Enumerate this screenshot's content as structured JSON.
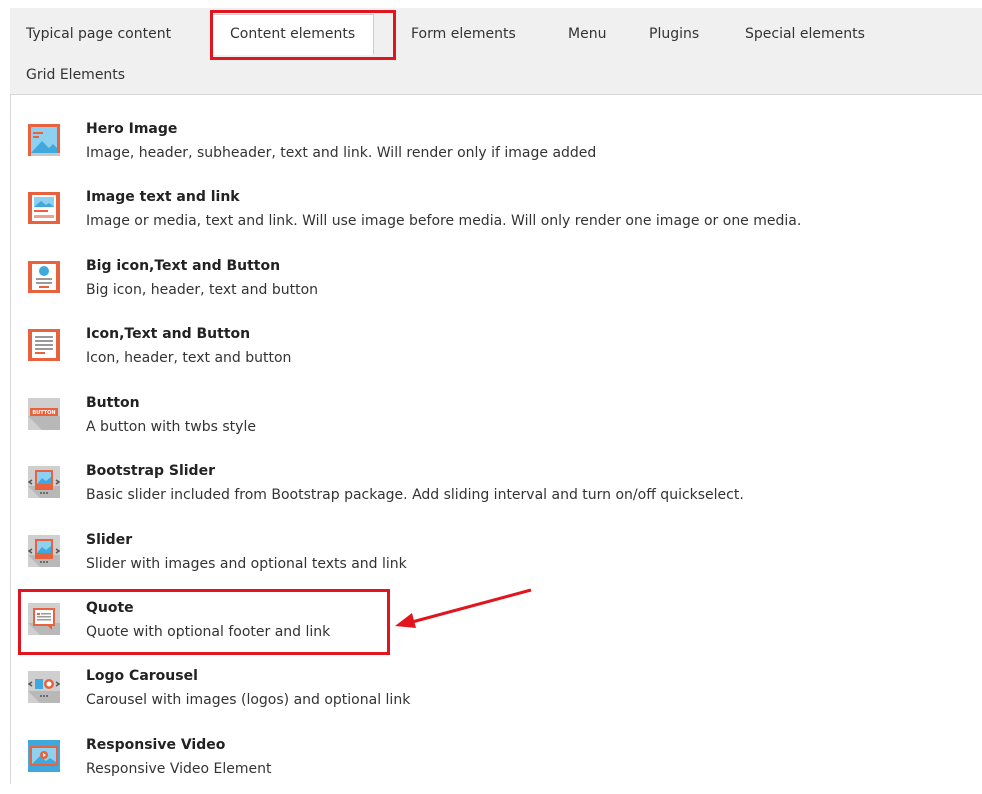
{
  "tabs": [
    {
      "label": "Typical page content"
    },
    {
      "label": "Content elements",
      "active": true
    },
    {
      "label": "Form elements"
    },
    {
      "label": "Menu"
    },
    {
      "label": "Plugins"
    },
    {
      "label": "Special elements"
    },
    {
      "label": "Grid Elements"
    }
  ],
  "items": [
    {
      "title": "Hero Image",
      "description": "Image, header, subheader, text and link. Will render only if image added",
      "icon": "hero-image-icon"
    },
    {
      "title": "Image text and link",
      "description": "Image or media, text and link. Will use image before media. Will only render one image or one media.",
      "icon": "image-text-link-icon"
    },
    {
      "title": "Big icon,Text and Button",
      "description": "Big icon, header, text and button",
      "icon": "big-icon-text-button-icon"
    },
    {
      "title": "Icon,Text and Button",
      "description": "Icon, header, text and button",
      "icon": "icon-text-button-icon"
    },
    {
      "title": "Button",
      "description": "A button with twbs style",
      "icon": "button-icon",
      "icon_text": "BUTTON"
    },
    {
      "title": "Bootstrap Slider",
      "description": "Basic slider included from Bootstrap package. Add sliding interval and turn on/off quickselect.",
      "icon": "bootstrap-slider-icon"
    },
    {
      "title": "Slider",
      "description": "Slider with images and optional texts and link",
      "icon": "slider-icon"
    },
    {
      "title": "Quote",
      "description": "Quote with optional footer and link",
      "icon": "quote-icon"
    },
    {
      "title": "Logo Carousel",
      "description": "Carousel with images (logos) and optional link",
      "icon": "logo-carousel-icon"
    },
    {
      "title": "Responsive Video",
      "description": "Responsive Video Element",
      "icon": "responsive-video-icon"
    }
  ],
  "colors": {
    "icon_orange": "#e8633d",
    "icon_blue": "#3fa9dd",
    "icon_grey": "#cfcfcf",
    "highlight_red": "#e2141e",
    "tab_bar_bg": "#f0f0f0"
  }
}
